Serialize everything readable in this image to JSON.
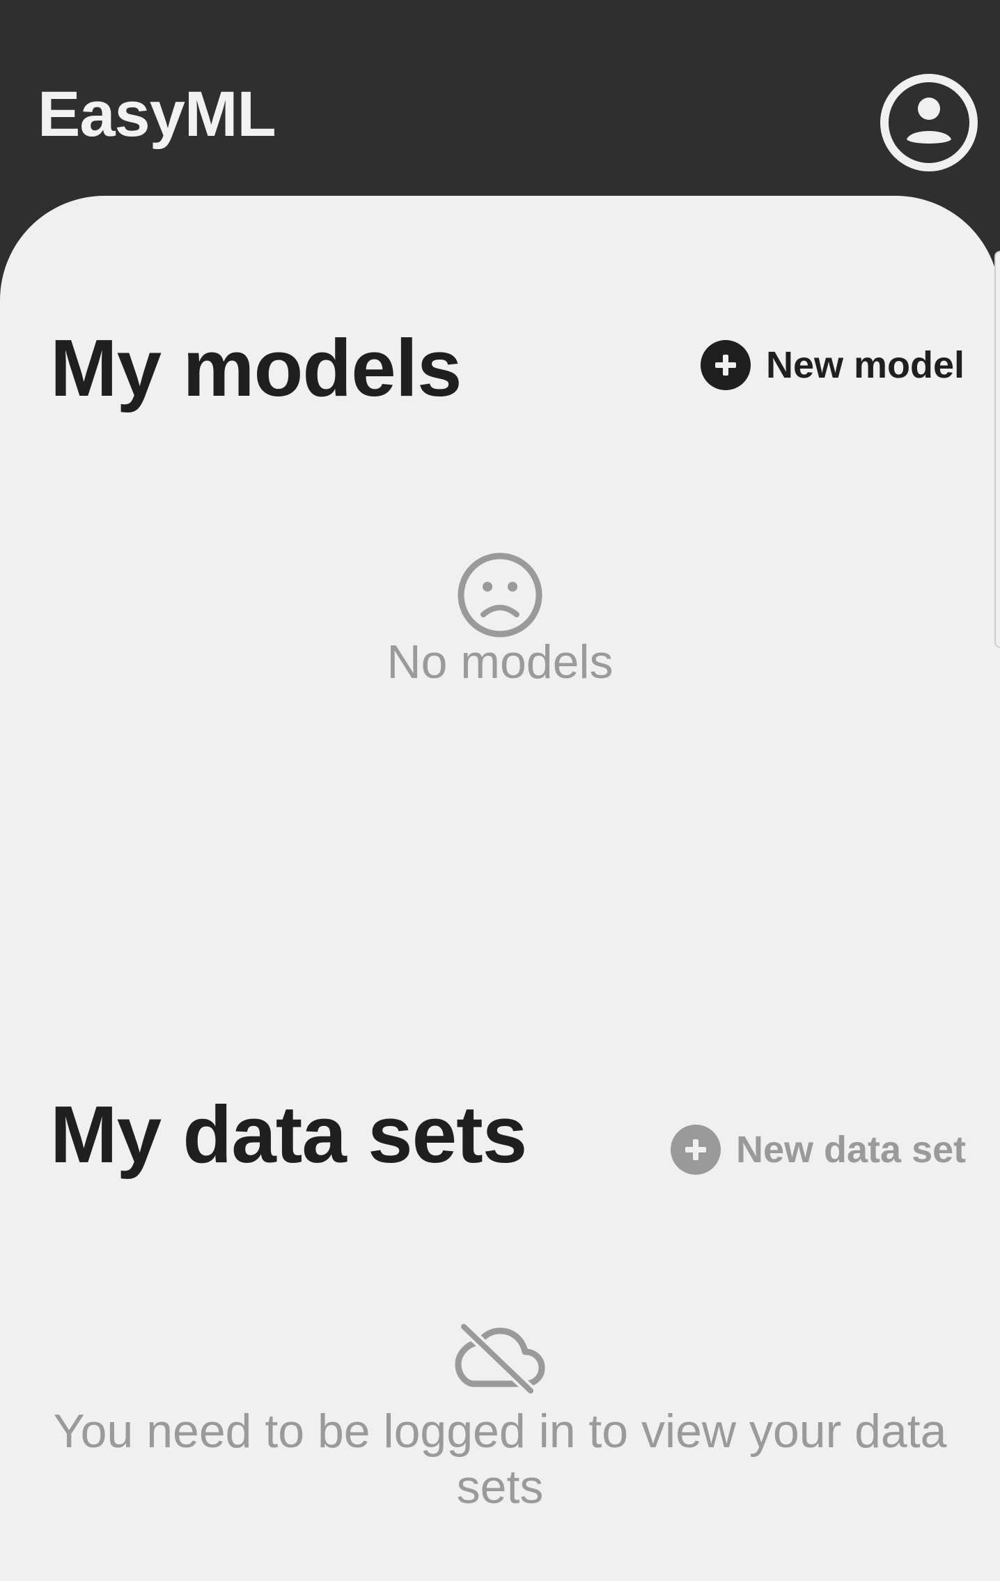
{
  "app": {
    "title": "EasyML"
  },
  "models": {
    "title": "My models",
    "new_button_label": "New model",
    "empty_text": "No models"
  },
  "datasets": {
    "title": "My data sets",
    "new_button_label": "New data set",
    "empty_text": "You need to be logged in to view your data sets"
  },
  "colors": {
    "app_bar": "#2f2f2f",
    "sheet": "#f0f0f0",
    "heading": "#1f1f1f",
    "muted": "#9a9a9a"
  },
  "icons": {
    "account": "account-circle-icon",
    "add": "add-circle-icon",
    "empty_models": "sad-face-icon",
    "empty_datasets": "cloud-off-icon"
  }
}
